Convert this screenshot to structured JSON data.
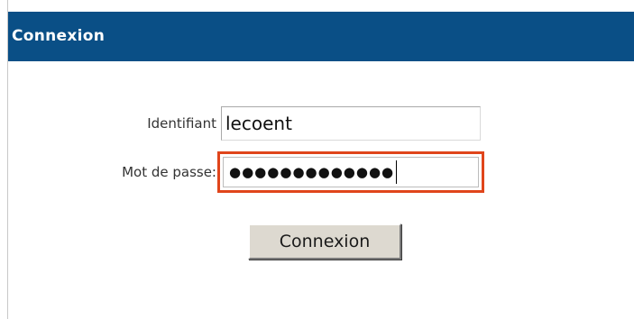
{
  "header": {
    "title": "Connexion"
  },
  "form": {
    "identifiant_label": "Identifiant",
    "identifiant_value": "lecoent",
    "password_label": "Mot de passe:",
    "password_masked": "●●●●●●●●●●●●●",
    "submit_label": "Connexion"
  },
  "colors": {
    "header_bg": "#0a4f86",
    "focus_border": "#e0451b",
    "button_bg": "#ddd9d0"
  }
}
